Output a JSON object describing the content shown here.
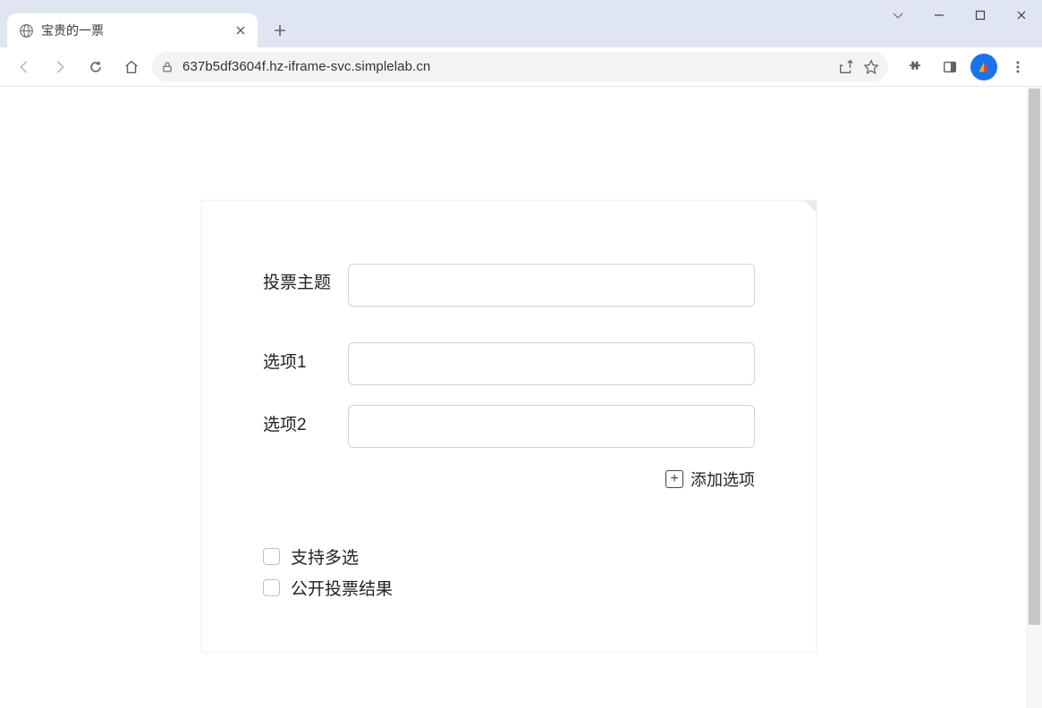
{
  "browser": {
    "tab_title": "宝贵的一票",
    "url": "637b5df3604f.hz-iframe-svc.simplelab.cn"
  },
  "form": {
    "topic_label": "投票主题",
    "option1_label": "选项1",
    "option2_label": "选项2",
    "topic_value": "",
    "option1_value": "",
    "option2_value": "",
    "add_option_label": "添加选项",
    "multi_select_label": "支持多选",
    "public_result_label": "公开投票结果",
    "multi_select_checked": false,
    "public_result_checked": false
  }
}
